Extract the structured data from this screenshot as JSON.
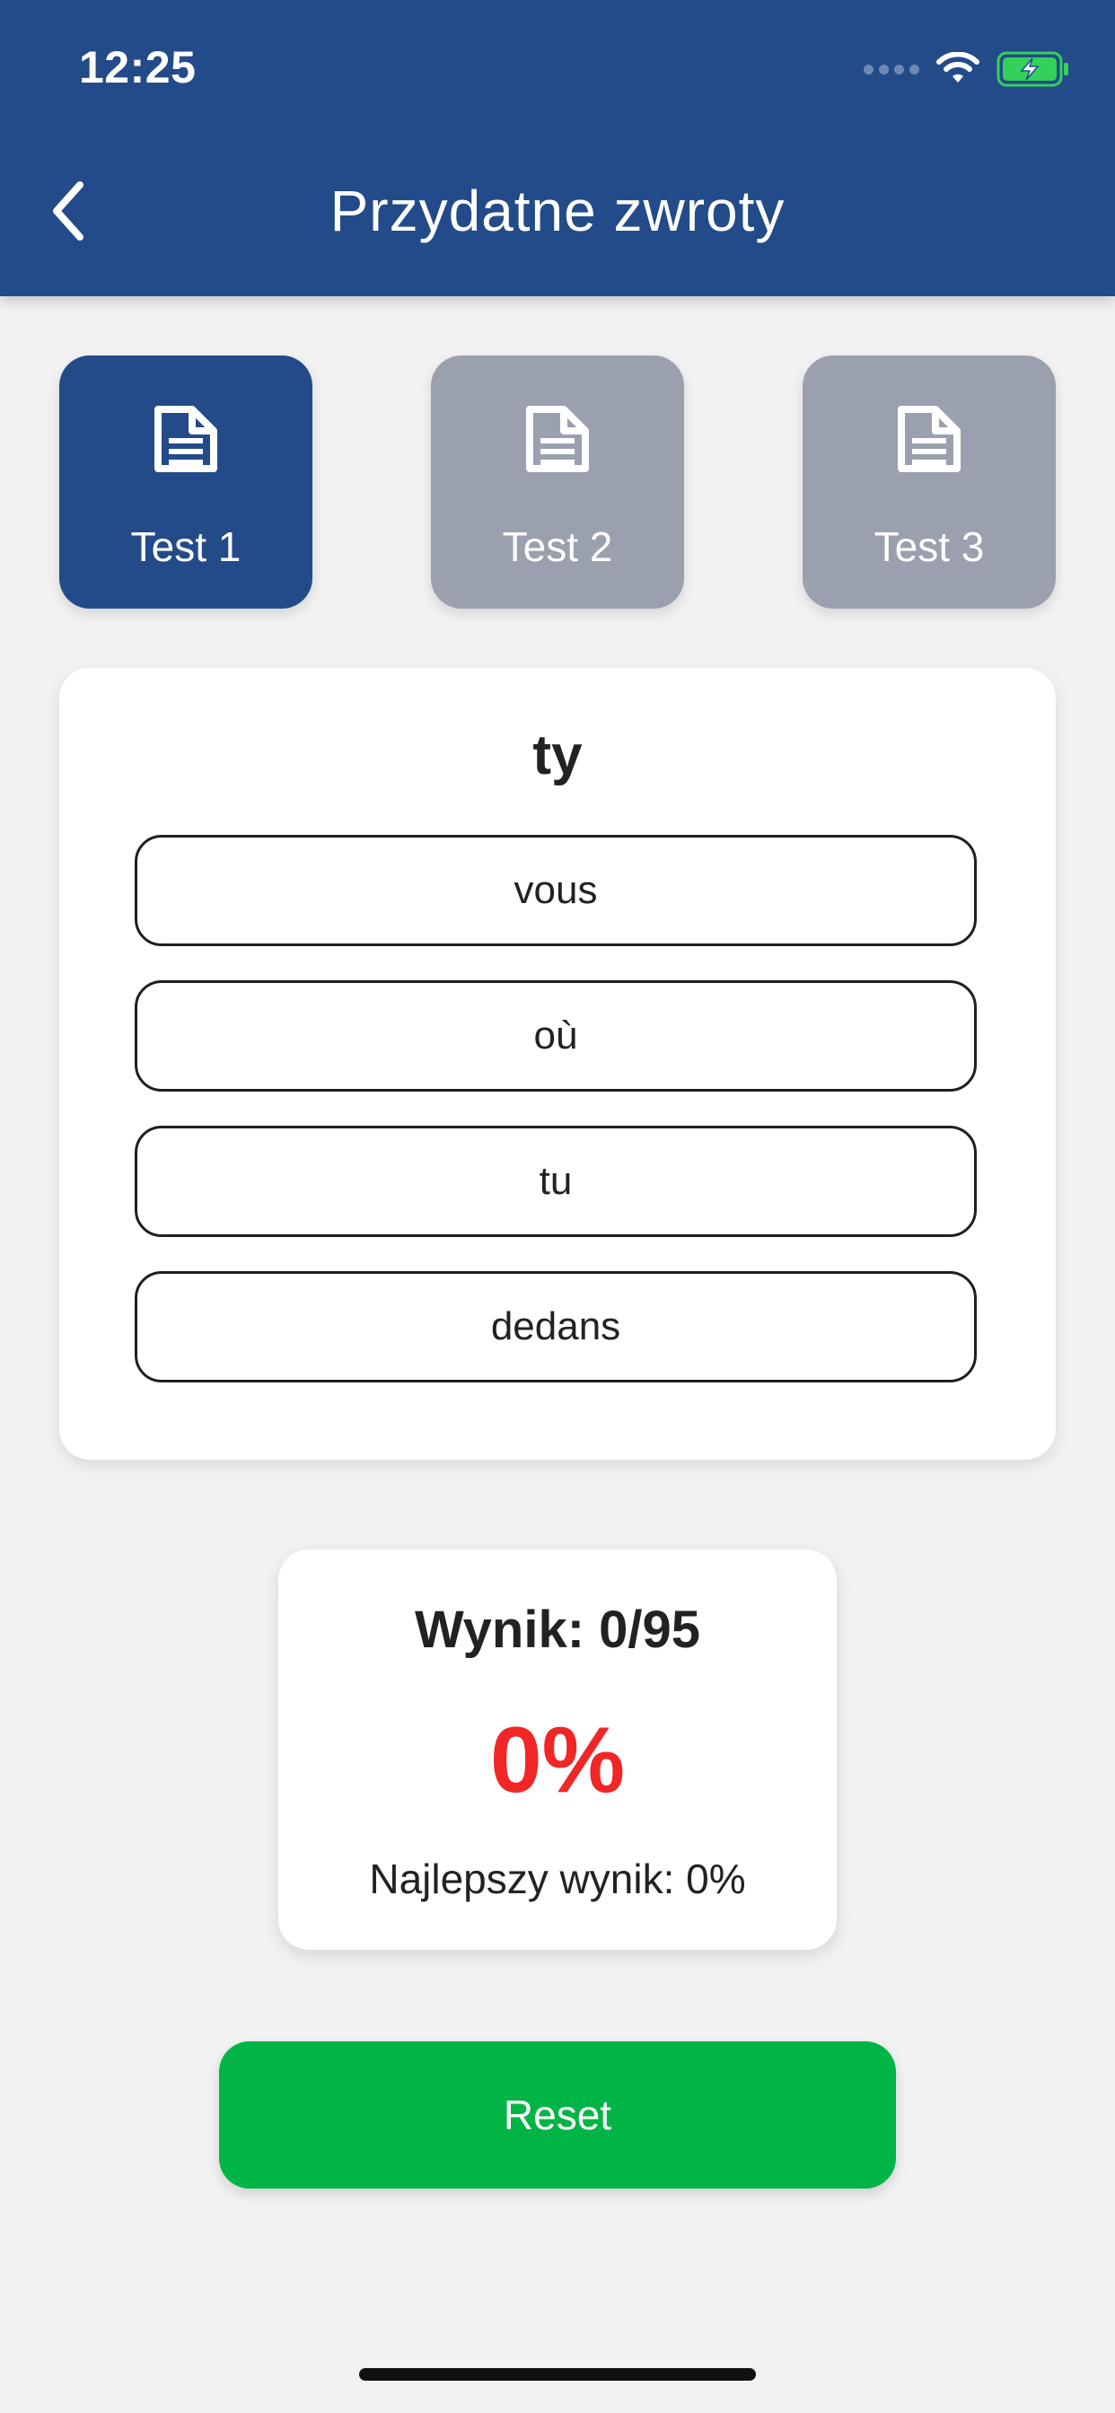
{
  "status_bar": {
    "time": "12:25"
  },
  "header": {
    "title": "Przydatne zwroty"
  },
  "tabs": [
    {
      "label": "Test 1",
      "active": true,
      "icon": "document-icon"
    },
    {
      "label": "Test 2",
      "active": false,
      "icon": "document-icon"
    },
    {
      "label": "Test 3",
      "active": false,
      "icon": "document-icon"
    }
  ],
  "quiz": {
    "question": "ty",
    "answers": [
      "vous",
      "où",
      "tu",
      "dedans"
    ]
  },
  "score": {
    "result_line": "Wynik: 0/95",
    "percent": "0%",
    "best": "Najlepszy wynik: 0%"
  },
  "actions": {
    "reset_label": "Reset"
  },
  "colors": {
    "header": "#234b89",
    "active_tab": "#234b89",
    "inactive_tab": "#9aa0ae",
    "percent": "#f12626",
    "reset": "#00b545",
    "battery": "#33d15a"
  }
}
